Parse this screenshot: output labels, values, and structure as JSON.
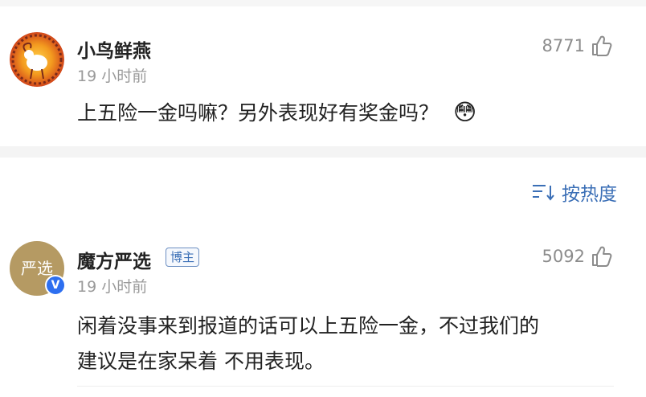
{
  "comments": [
    {
      "username": "小鸟鲜燕",
      "time": "19 小时前",
      "text": "上五险一金吗嘛？另外表现好有奖金吗？",
      "emoji": "😳",
      "likes": "8771",
      "avatar_icon": "sun-ram-icon"
    },
    {
      "username": "魔方严选",
      "badge": "博主",
      "time": "19 小时前",
      "text_line1": "闲着没事来到报道的话可以上五险一金，不过我们的",
      "text_line2": "建议是在家呆着 不用表现。",
      "likes": "5092",
      "avatar_text": "严选",
      "verified_mark": "V"
    }
  ],
  "sort": {
    "label": "按热度",
    "icon": "sort-icon"
  },
  "colors": {
    "accent": "#3b6fb6",
    "verified": "#2d6ff0"
  }
}
